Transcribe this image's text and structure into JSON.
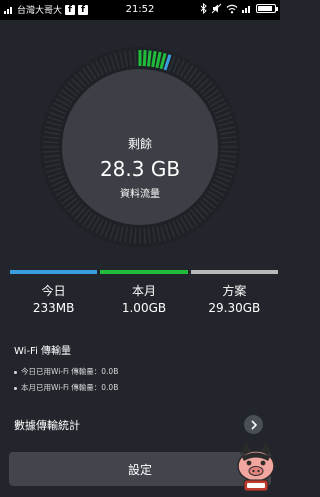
{
  "status_bar": {
    "carrier": "台灣大哥大",
    "fb_badge": "f",
    "time": "21:52",
    "icons": [
      "signal-icon",
      "facebook-icon",
      "facebook-icon",
      "bluetooth-icon",
      "mute-icon",
      "wifi-icon",
      "signal-icon",
      "battery-icon"
    ],
    "battery_level": 0.85
  },
  "gauge": {
    "label": "剩餘",
    "value": "28.3 GB",
    "sub_label": "資料流量",
    "used_fraction": 0.06,
    "colors": {
      "ring": "#1e2126",
      "disc": "#3c3f45",
      "used": "#1fbd3a",
      "today": "#3a9de0"
    }
  },
  "stats": [
    {
      "label": "今日",
      "value": "233MB",
      "color": "#3a9de0"
    },
    {
      "label": "本月",
      "value": "1.00GB",
      "color": "#1fbd3a"
    },
    {
      "label": "方案",
      "value": "29.30GB",
      "color": "#b9b9b9"
    }
  ],
  "wifi": {
    "title": "Wi-Fi 傳輸量",
    "today": "今日已用Wi-Fi 傳輸量：0.0B",
    "month": "本月已用Wi-Fi 傳輸量：0.0B"
  },
  "stats_link": {
    "label": "數據傳輸統計",
    "icon": "chevron-right-icon"
  },
  "settings_button": {
    "label": "設定"
  },
  "watermark": {
    "icon": "pig-mascot-logo"
  }
}
